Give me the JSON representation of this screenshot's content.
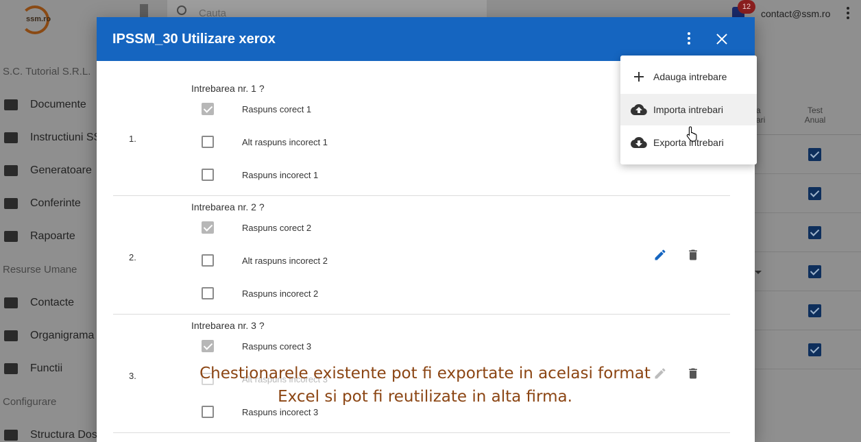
{
  "app": {
    "logo_text": "ssm.ro",
    "search_placeholder": "Cauta",
    "notification_count": "12",
    "user_email": "contact@ssm.ro"
  },
  "sidebar": {
    "company": "S.C. Tutorial S.R.L.",
    "items_main": [
      {
        "label": "Documente",
        "icon": "folder-icon"
      },
      {
        "label": "Instructiuni SS",
        "icon": "chat-icon"
      },
      {
        "label": "Generatoare",
        "icon": "folder-star-icon"
      },
      {
        "label": "Conferinte",
        "icon": "phone-icon"
      },
      {
        "label": "Rapoarte",
        "icon": "calendar-icon"
      }
    ],
    "section_hr": "Resurse Umane",
    "items_hr": [
      {
        "label": "Contacte",
        "icon": "person-icon"
      },
      {
        "label": "Organigrama",
        "icon": "list-icon"
      },
      {
        "label": "Functii",
        "icon": "clipboard-icon"
      }
    ],
    "section_config": "Configurare",
    "items_config": [
      {
        "label": "Structura Dos",
        "icon": "folder-star-icon"
      }
    ]
  },
  "background_table": {
    "col1_header": "a\nari",
    "col2_header": "Test\nAnual",
    "checked_rows": 6
  },
  "dialog": {
    "title": "IPSSM_30 Utilizare xerox",
    "questions": [
      {
        "number": "1.",
        "title": "Intrebarea nr. 1 ?",
        "answers": [
          {
            "text": "Raspuns corect 1",
            "checked": true
          },
          {
            "text": "Alt raspuns incorect 1",
            "checked": false
          },
          {
            "text": "Raspuns incorect 1",
            "checked": false
          }
        ]
      },
      {
        "number": "2.",
        "title": "Intrebarea nr. 2 ?",
        "answers": [
          {
            "text": "Raspuns corect 2",
            "checked": true
          },
          {
            "text": "Alt raspuns incorect 2",
            "checked": false
          },
          {
            "text": "Raspuns incorect 2",
            "checked": false
          }
        ]
      },
      {
        "number": "3.",
        "title": "Intrebarea nr. 3 ?",
        "answers": [
          {
            "text": "Raspuns corect 3",
            "checked": true
          },
          {
            "text": "Alt raspuns incorect 3",
            "checked": false
          },
          {
            "text": "Raspuns incorect 3",
            "checked": false
          }
        ]
      }
    ]
  },
  "menu": {
    "items": [
      {
        "label": "Adauga intrebare",
        "icon": "plus-icon"
      },
      {
        "label": "Importa intrebari",
        "icon": "cloud-upload-icon"
      },
      {
        "label": "Exporta intrebari",
        "icon": "cloud-download-icon"
      }
    ]
  },
  "caption": {
    "line1": "Chestionarele existente pot fi exportate in acelasi format",
    "line2": "Excel si pot fi reutilizate in alta firma."
  },
  "colors": {
    "dialog_header": "#1565c0",
    "edit_icon": "#1565c0",
    "caption": "#8b4513"
  }
}
